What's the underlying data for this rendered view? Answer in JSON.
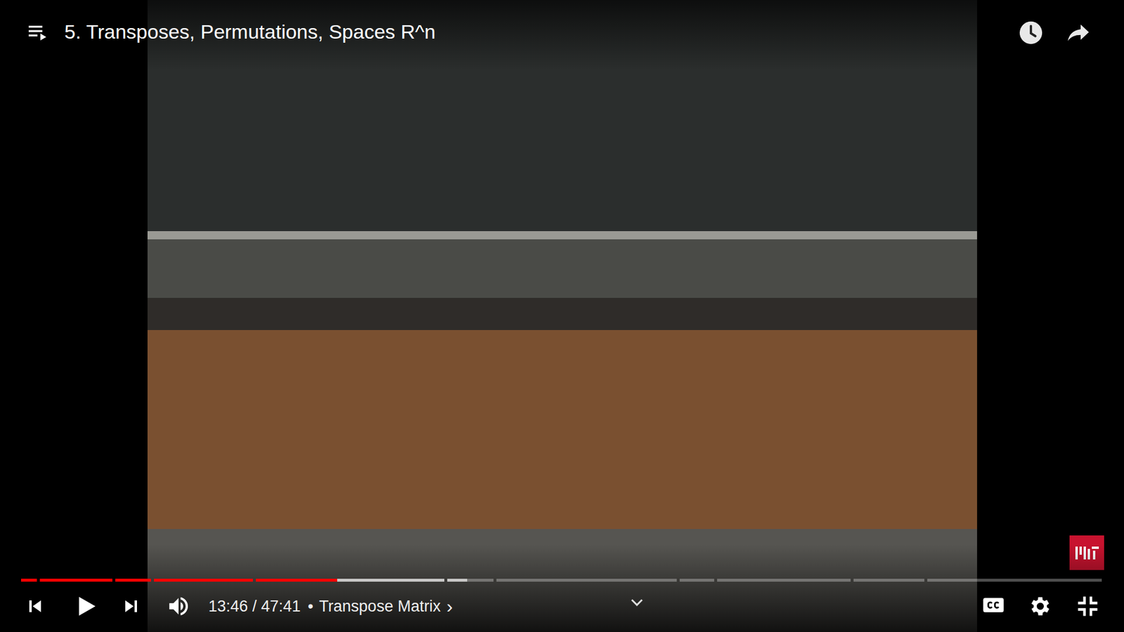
{
  "player": {
    "title": "5. Transposes, Permutations, Spaces R^n"
  },
  "progress": {
    "played": 0.289,
    "buffered": 0.41,
    "chapters": [
      {
        "length": 0.015
      },
      {
        "length": 0.069
      },
      {
        "length": 0.034
      },
      {
        "length": 0.094
      },
      {
        "length": 0.179
      },
      {
        "length": 0.044
      },
      {
        "length": 0.171
      },
      {
        "length": 0.033
      },
      {
        "length": 0.127
      },
      {
        "length": 0.067
      },
      {
        "length": 0.166
      }
    ]
  },
  "controls": {
    "time": "13:46 / 47:41",
    "separator": "•",
    "chapter": "Transpose Matrix",
    "chapter_arrow": "›",
    "playing": false,
    "captions_on": false,
    "fullscreen": true
  }
}
